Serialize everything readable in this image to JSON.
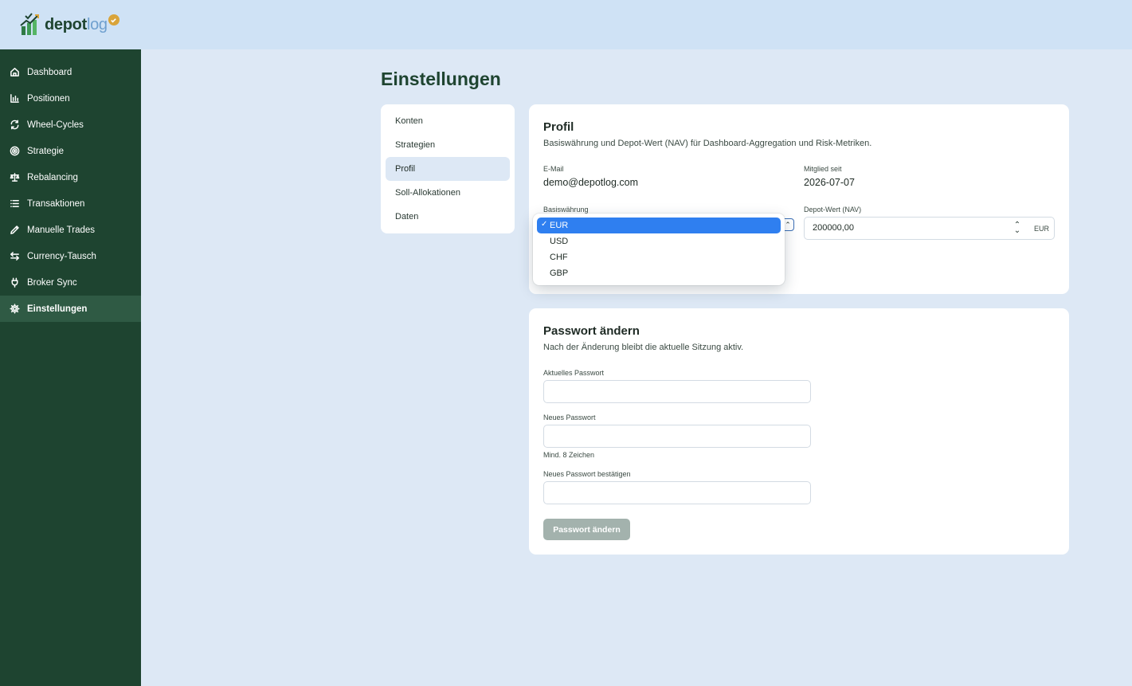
{
  "brand": {
    "name_part1": "depot",
    "name_part2": "log"
  },
  "sidebar": {
    "items": [
      {
        "label": "Dashboard",
        "icon": "home-icon"
      },
      {
        "label": "Positionen",
        "icon": "bar-chart-icon"
      },
      {
        "label": "Wheel-Cycles",
        "icon": "refresh-icon"
      },
      {
        "label": "Strategie",
        "icon": "target-icon"
      },
      {
        "label": "Rebalancing",
        "icon": "scale-icon"
      },
      {
        "label": "Transaktionen",
        "icon": "list-icon"
      },
      {
        "label": "Manuelle Trades",
        "icon": "pencil-icon"
      },
      {
        "label": "Currency-Tausch",
        "icon": "swap-icon"
      },
      {
        "label": "Broker Sync",
        "icon": "plug-icon"
      },
      {
        "label": "Einstellungen",
        "icon": "gear-icon",
        "active": true
      }
    ]
  },
  "page": {
    "title": "Einstellungen"
  },
  "subnav": {
    "items": [
      {
        "label": "Konten"
      },
      {
        "label": "Strategien"
      },
      {
        "label": "Profil",
        "active": true
      },
      {
        "label": "Soll-Allokationen"
      },
      {
        "label": "Daten"
      }
    ]
  },
  "profil": {
    "title": "Profil",
    "subtitle": "Basiswährung und Depot-Wert (NAV) für Dashboard-Aggregation und Risk-Metriken.",
    "email_label": "E-Mail",
    "email_value": "demo@depotlog.com",
    "member_label": "Mitglied seit",
    "member_value": "2026-07-07",
    "currency_label": "Basiswährung",
    "currency_options": [
      "EUR",
      "USD",
      "CHF",
      "GBP"
    ],
    "currency_selected": "EUR",
    "check_mark": "✓",
    "nav_label": "Depot-Wert (NAV)",
    "nav_value": "200000,00",
    "nav_currency": "EUR"
  },
  "password": {
    "title": "Passwort ändern",
    "subtitle": "Nach der Änderung bleibt die aktuelle Sitzung aktiv.",
    "current_label": "Aktuelles Passwort",
    "new_label": "Neues Passwort",
    "new_hint": "Mind. 8 Zeichen",
    "confirm_label": "Neues Passwort bestätigen",
    "submit_label": "Passwort ändern"
  },
  "colors": {
    "sidebar_bg": "#1e4430",
    "topbar_bg": "#cfe2f5",
    "page_bg": "#dde8f5",
    "accent_selected": "#2f7ff0",
    "disabled_button": "#a3b2ad",
    "logo_badge": "#d9a43a"
  }
}
